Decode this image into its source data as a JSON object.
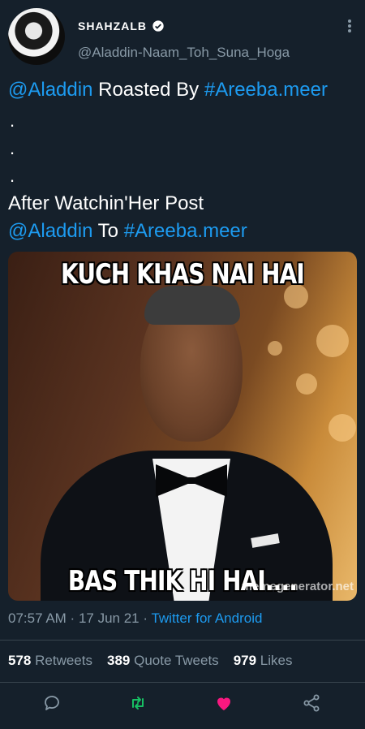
{
  "author": {
    "display_name": "SHAHZALB",
    "handle": "@Aladdin-Naam_Toh_Suna_Hoga"
  },
  "tweet": {
    "line1_mention": "@Aladdin",
    "line1_text": " Roasted By ",
    "line1_hashtag": "#Areeba.meer",
    "dot1": ".",
    "dot2": ".",
    "dot3": ".",
    "line4": "After Watchin'Her Post",
    "line5_mention": "@Aladdin",
    "line5_text": " To ",
    "line5_hashtag": "#Areeba.meer"
  },
  "media": {
    "top_caption": "KUCH KHAS NAI HAI",
    "bottom_caption": "BAS THIK HI HAI.... HMM",
    "watermark": "memegenerator.net"
  },
  "meta": {
    "time": "07:57 AM",
    "separator": " · ",
    "date": "17 Jun 21",
    "separator2": " · ",
    "source": "Twitter for Android"
  },
  "stats": {
    "retweets_count": "578",
    "retweets_label": "Retweets",
    "quotes_count": "389",
    "quotes_label": "Quote Tweets",
    "likes_count": "979",
    "likes_label": "Likes"
  },
  "actions": {
    "reply_icon": "reply-icon",
    "retweet_icon": "retweet-icon",
    "like_icon": "heart-icon",
    "share_icon": "share-icon"
  },
  "colors": {
    "background": "#15202b",
    "link": "#1d9bf0",
    "secondary_text": "#8899a6",
    "retweet_active": "#17bf63",
    "like_active": "#f91880"
  }
}
